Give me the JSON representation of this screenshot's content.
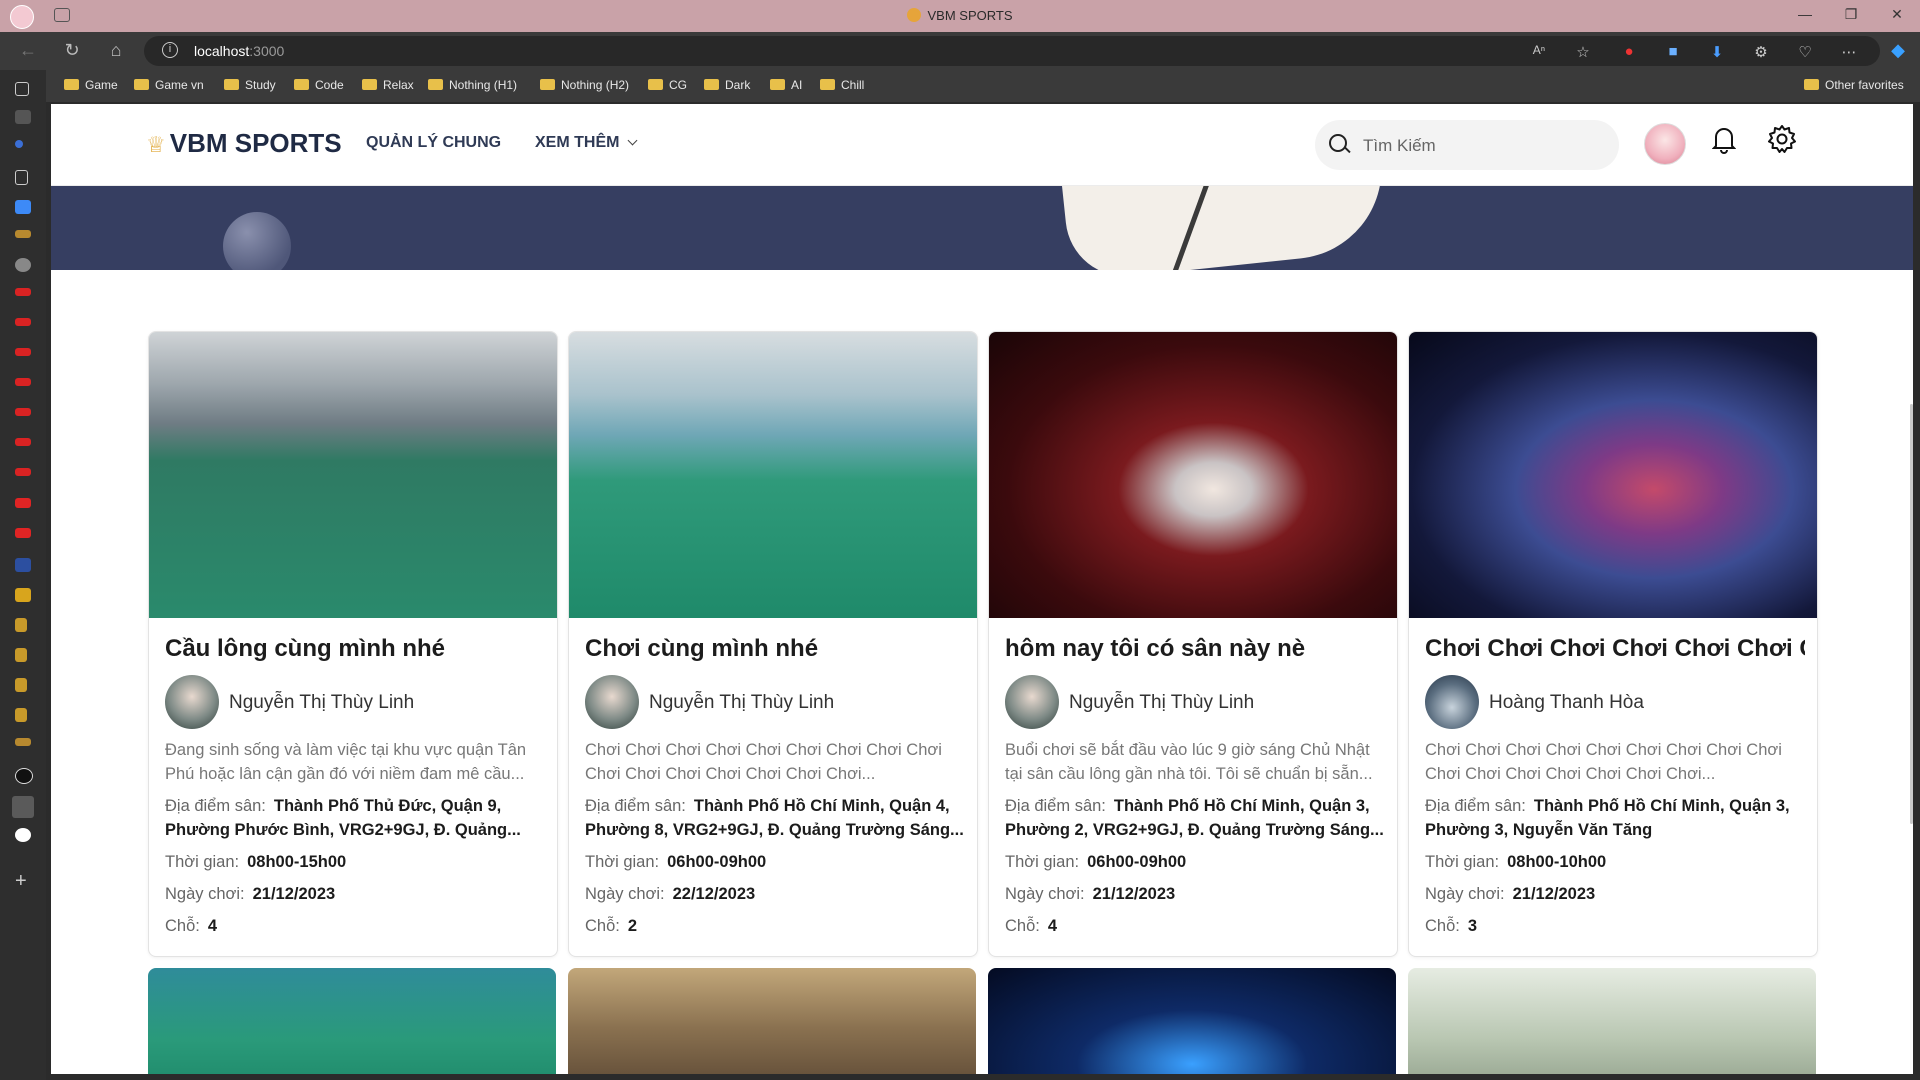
{
  "browser": {
    "window_title": "VBM SPORTS",
    "url_host": "localhost",
    "url_port": ":3000",
    "bookmarks": [
      "Game",
      "Game vn",
      "Study",
      "Code",
      "Relax",
      "Nothing (H1)",
      "Nothing (H2)",
      "CG",
      "Dark",
      "AI",
      "Chill"
    ],
    "other_favorites": "Other favorites"
  },
  "header": {
    "logo": "VBM SPORTS",
    "menu_manage": "QUẢN LÝ CHUNG",
    "menu_more": "XEM THÊM",
    "search_placeholder": "Tìm Kiếm"
  },
  "labels": {
    "location": "Địa điểm sân:",
    "time": "Thời gian:",
    "date": "Ngày chơi:",
    "slots": "Chỗ:"
  },
  "cards": [
    {
      "title": "Cầu lông cùng mình nhé",
      "author": "Nguyễn Thị Thùy Linh",
      "description": "Đang sinh sống và làm việc tại khu vực quận Tân Phú hoặc lân cận gần đó với niềm đam mê cầu...",
      "location": "Thành Phố Thủ Đức, Quận 9, Phường Phước Bình, VRG2+9GJ, Đ. Quảng...",
      "time": "08h00-15h00",
      "date": "21/12/2023",
      "slots": "4"
    },
    {
      "title": "Chơi cùng mình nhé",
      "author": "Nguyễn Thị Thùy Linh",
      "description": "Chơi Chơi Chơi Chơi Chơi Chơi Chơi Chơi Chơi Chơi Chơi Chơi Chơi Chơi Chơi Chơi...",
      "location": "Thành Phố Hồ Chí Minh, Quận 4, Phường 8, VRG2+9GJ, Đ. Quảng Trường Sáng...",
      "time": "06h00-09h00",
      "date": "22/12/2023",
      "slots": "2"
    },
    {
      "title": "hôm nay tôi có sân này nè",
      "author": "Nguyễn Thị Thùy Linh",
      "description": "Buổi chơi sẽ bắt đầu vào lúc 9 giờ sáng Chủ Nhật tại sân cầu lông gần nhà tôi. Tôi sẽ chuẩn bị sẵn...",
      "location": "Thành Phố Hồ Chí Minh, Quận 3, Phường 2, VRG2+9GJ, Đ. Quảng Trường Sáng...",
      "time": "06h00-09h00",
      "date": "21/12/2023",
      "slots": "4"
    },
    {
      "title": "Chơi Chơi Chơi Chơi Chơi Chơi C",
      "author": "Hoàng Thanh Hòa",
      "description": "Chơi Chơi Chơi Chơi Chơi Chơi Chơi Chơi Chơi Chơi Chơi Chơi Chơi Chơi Chơi Chơi...",
      "location": "Thành Phố Hồ Chí Minh, Quận 3, Phường 3, Nguyễn Văn Tăng",
      "time": "08h00-10h00",
      "date": "21/12/2023",
      "slots": "3"
    }
  ]
}
